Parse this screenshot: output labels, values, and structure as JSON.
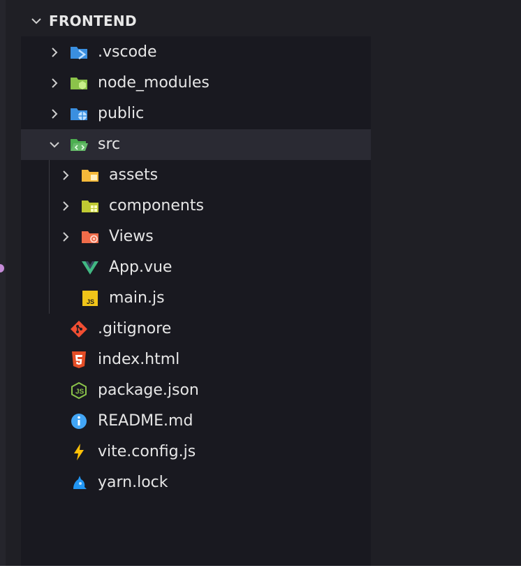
{
  "explorer": {
    "title": "FRONTEND",
    "items": [
      {
        "label": ".vscode"
      },
      {
        "label": "node_modules"
      },
      {
        "label": "public"
      },
      {
        "label": "src"
      },
      {
        "label": "assets"
      },
      {
        "label": "components"
      },
      {
        "label": "Views"
      },
      {
        "label": "App.vue"
      },
      {
        "label": "main.js"
      },
      {
        "label": ".gitignore"
      },
      {
        "label": "index.html"
      },
      {
        "label": "package.json"
      },
      {
        "label": "README.md"
      },
      {
        "label": "vite.config.js"
      },
      {
        "label": "yarn.lock"
      }
    ]
  },
  "icons": {
    "vscode": "vscode-folder-icon",
    "node_modules": "node-folder-icon",
    "public": "public-folder-icon",
    "src": "src-folder-open-icon",
    "assets": "assets-folder-icon",
    "components": "components-folder-icon",
    "views": "views-folder-icon",
    "vue": "vue-icon",
    "js": "javascript-icon",
    "git": "git-icon",
    "html": "html5-icon",
    "node": "nodejs-icon",
    "info": "info-icon",
    "vite": "vite-icon",
    "yarn": "yarn-icon"
  },
  "colors": {
    "background": "#1f1f25",
    "tree_background": "#191920",
    "selected_row": "#2a2a33",
    "text": "#e6e6e6"
  }
}
